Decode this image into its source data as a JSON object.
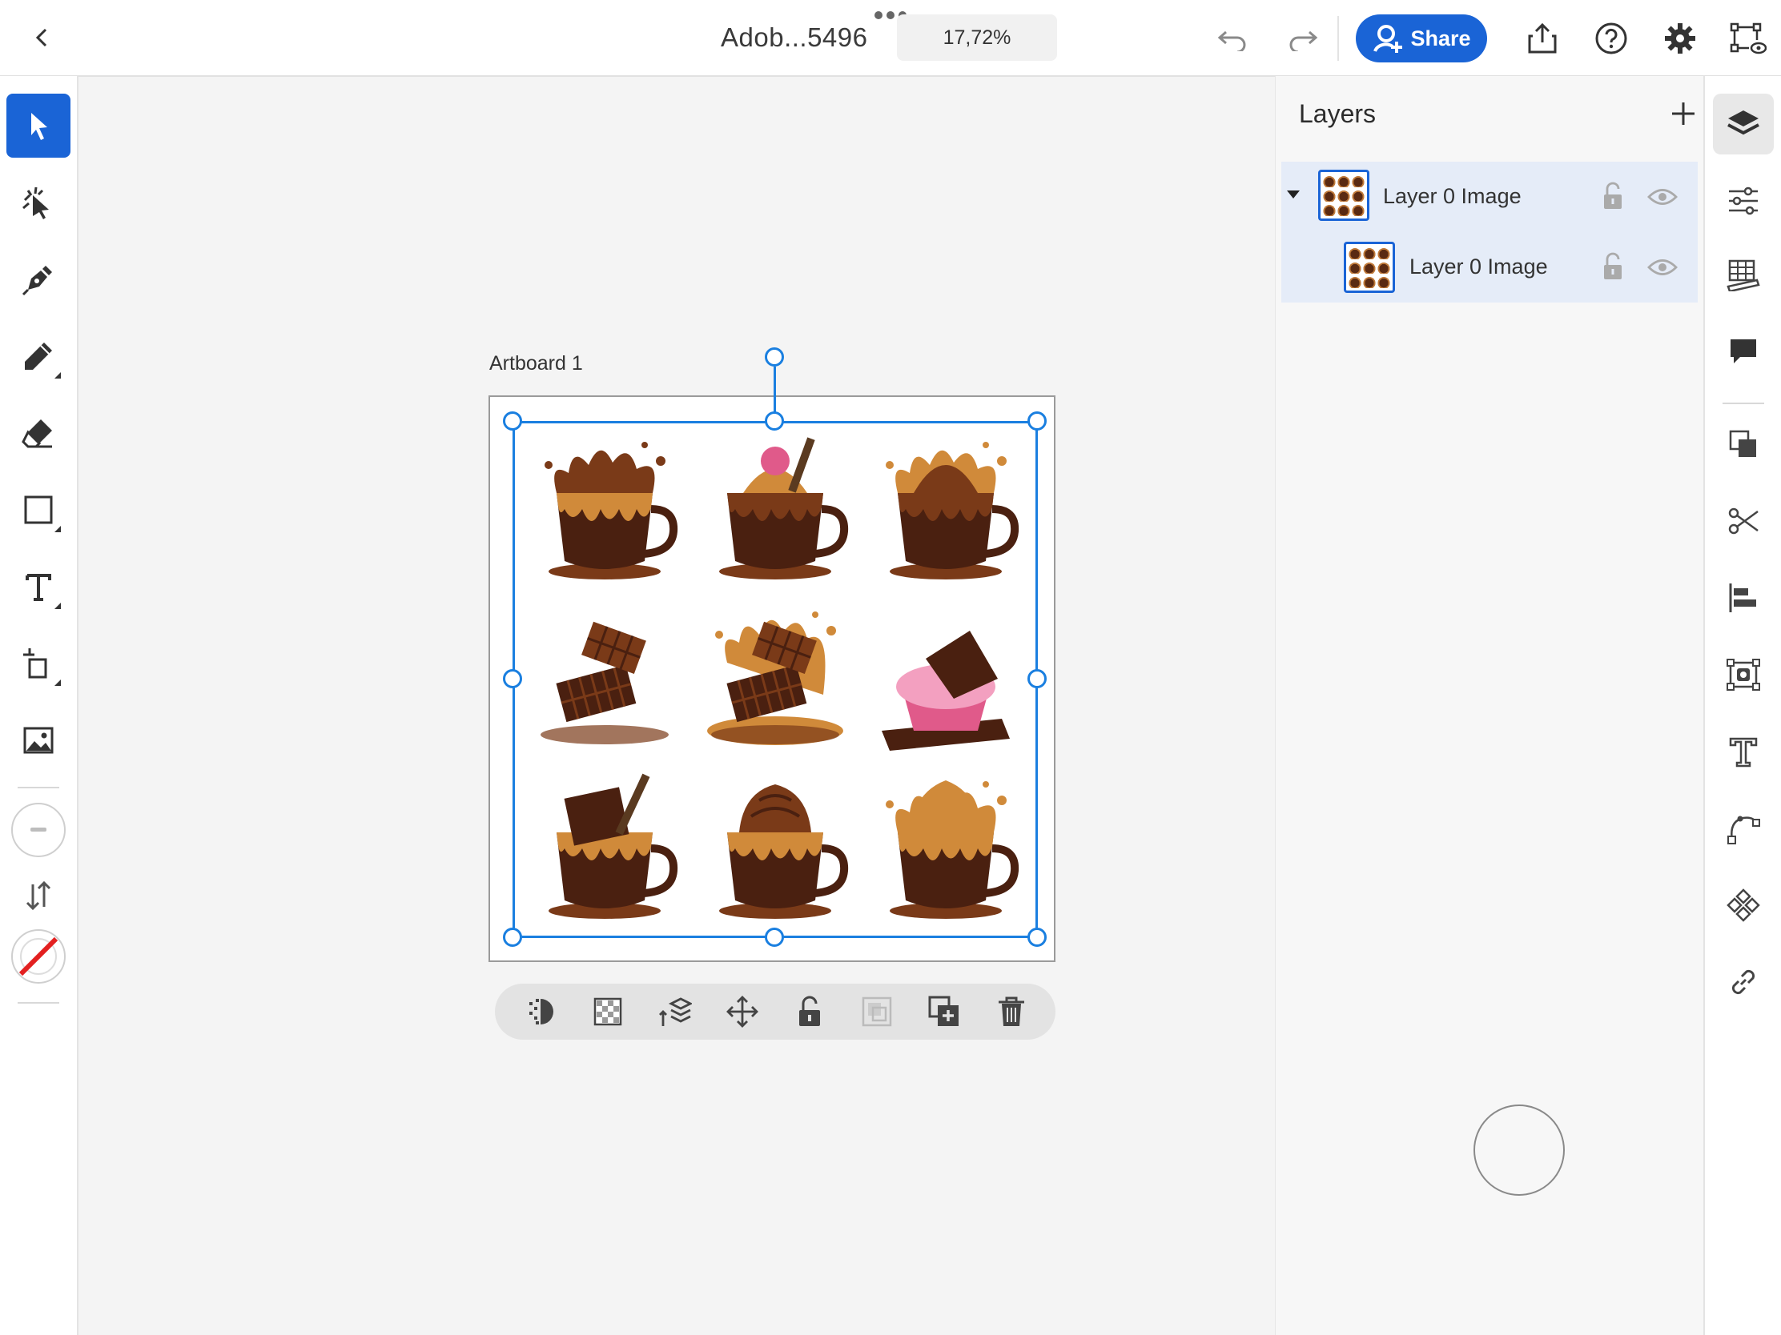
{
  "topbar": {
    "document_title": "Adob...5496",
    "zoom": "17,72%",
    "share_label": "Share"
  },
  "artboard": {
    "label": "Artboard 1"
  },
  "layers": {
    "title": "Layers",
    "items": [
      {
        "name": "Layer 0 Image",
        "expanded": true,
        "selected": true
      },
      {
        "name": "Layer 0 Image",
        "child": true,
        "selected": true
      }
    ]
  },
  "left_tools": [
    "select-tool",
    "smudge-tool",
    "pen-tool",
    "pencil-tool",
    "eraser-tool",
    "rectangle-tool",
    "text-tool",
    "crop-tool",
    "image-tool"
  ],
  "right_rail": [
    "layers",
    "properties",
    "grids",
    "comments",
    "arrange",
    "cut",
    "align",
    "auto-fit",
    "type",
    "path",
    "repeat-grid",
    "link"
  ],
  "colors": {
    "accent": "#1a64d6",
    "selection": "#1a7fe0",
    "chocolate_dark": "#4a2010",
    "chocolate": "#7a3a18",
    "caramel": "#d08a3a",
    "pink": "#e05a8a"
  },
  "image_tiles": [
    "cup-splash",
    "cup-raspberry",
    "cup-caramel-swirl",
    "chocolate-bars",
    "chocolate-splash",
    "pink-cupcake",
    "cup-chocolate-bar",
    "cup-chocolate-cream",
    "cup-caramel-cream"
  ]
}
